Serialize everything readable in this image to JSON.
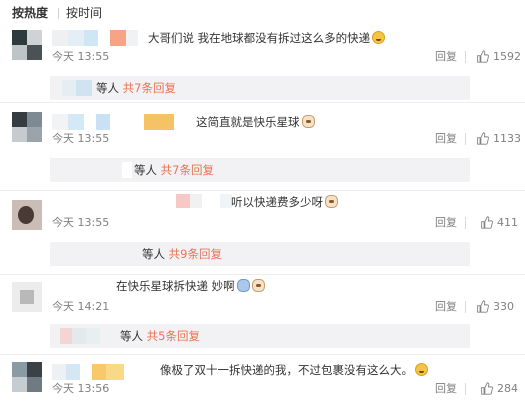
{
  "sort": {
    "hot_label": "按热度",
    "time_label": "按时间"
  },
  "colors": {
    "link": "#eb7350",
    "muted": "#808080",
    "text": "#333333"
  },
  "icons": {
    "like": "thumbs-up-icon",
    "face_smile": "laughing-face-icon",
    "face_pet": "pet-face-icon"
  },
  "comments": [
    {
      "text": "大哥们说 我在地球都没有拆过这么多的快递",
      "emoji": "laughing-face-icon",
      "time": "今天 13:55",
      "reply_label": "回复",
      "likes": "1592",
      "sub": {
        "who": "等人",
        "more": "共7条回复"
      }
    },
    {
      "text": "这简直就是快乐星球",
      "emoji": "pet-face-icon",
      "time": "今天 13:55",
      "reply_label": "回复",
      "likes": "1133",
      "sub": {
        "who": "等人",
        "more": "共7条回复"
      }
    },
    {
      "text": "听以快递费多少呀",
      "emoji": "pet-face-icon",
      "time": "今天 13:55",
      "reply_label": "回复",
      "likes": "411",
      "sub": {
        "who": "等人",
        "more": "共9条回复"
      }
    },
    {
      "text": "在快乐星球拆快递  妙啊",
      "emoji": "pet-face-icon",
      "time": "今天 14:21",
      "reply_label": "回复",
      "likes": "330",
      "sub": {
        "who": "等人",
        "more": "共5条回复"
      }
    },
    {
      "text": "像极了双十一拆快递的我，不过包裹没有这么大。",
      "emoji": "laughing-face-icon",
      "time": "今天 13:56",
      "reply_label": "回复",
      "likes": "284"
    }
  ]
}
